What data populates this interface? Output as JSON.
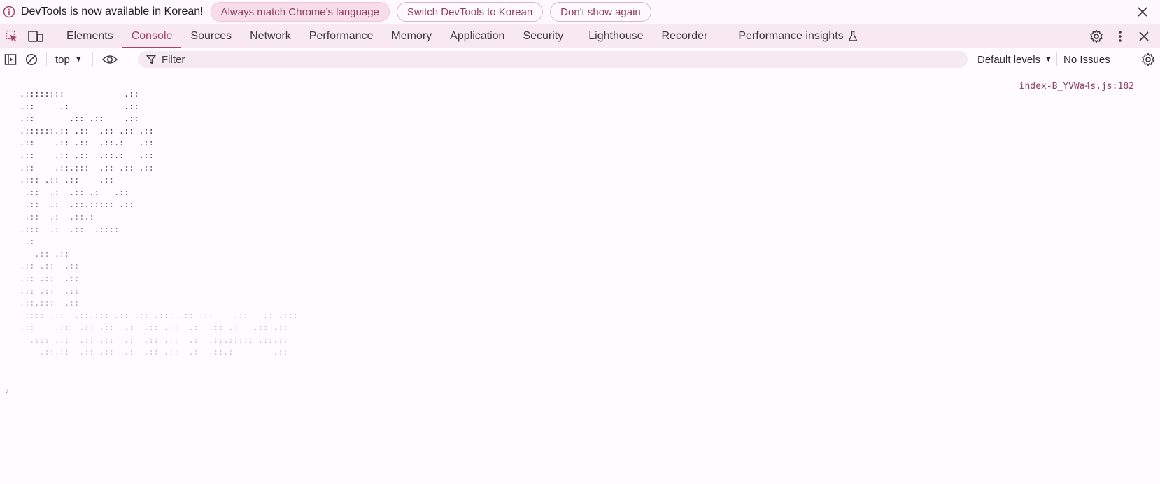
{
  "infobar": {
    "icon": "info-icon",
    "message": "DevTools is now available in Korean!",
    "buttons": [
      "Always match Chrome's language",
      "Switch DevTools to Korean",
      "Don't show again"
    ]
  },
  "tabs": {
    "items": [
      "Elements",
      "Console",
      "Sources",
      "Network",
      "Performance",
      "Memory",
      "Application",
      "Security",
      "Lighthouse",
      "Recorder",
      "Performance insights"
    ],
    "active": "Console"
  },
  "toolbar": {
    "context": "top",
    "filter_placeholder": "Filter",
    "levels": "Default levels",
    "issues": "No Issues"
  },
  "console": {
    "source": "index-B_YVWa4s.js:182",
    "art_lines": [
      ".::::::::            .::",
      ".::     .:           .::",
      ".::       .:: .::    .::",
      ".::::::.:: .::  .:: .:: .::",
      ".::    .:: .::  .::.:   .::",
      ".::    .:: .::  .::.:   .::",
      ".::    .::.:::  .:: .:: .::",
      ".::: .:: .::    .::",
      " .::  .:  .:: .:   .::",
      " .::  .:  .::.::::: .::",
      " .::  .:  .::.:",
      ".:::  .:  .::  .::::",
      " .:",
      "   .:: .::",
      ".:: .::  .::",
      ".:: .::  .::",
      ".:: .::  .::",
      ".::.:::  .::",
      ".:::: .::  .::.::: .:: .:: .::: .:: .::    .::   .: .:::",
      ".::    .::  .:: .::  .:  .:: .::  .:  .:: .:   .:: .::",
      "  .::: .::  .:: .::  .:  .:: .::  .:  .::.::::: .::.::",
      "    .::.::  .:: .::  .:  .:: .::  .:  .::.:        .::"
    ],
    "art_colors": [
      "#2b2b2b",
      "#3a3a3a",
      "#4a4a4a",
      "#5a5a5a",
      "#6a6a6a",
      "#7a7a7a",
      "#8a8a8a",
      "#9a9a9a",
      "#a8a8a8",
      "#b5b5b5",
      "#c2c2c2"
    ],
    "prompt": "›"
  },
  "colors": {
    "accent": "#a24469",
    "tab_bar_bg": "#f7e9ef",
    "pill_border": "#d9b7c6"
  }
}
